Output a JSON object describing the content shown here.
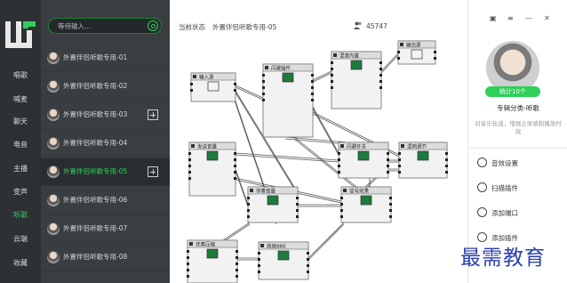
{
  "nav": {
    "items": [
      "唱歌",
      "喊麦",
      "聊天",
      "电音",
      "主播",
      "变声",
      "听歌",
      "云端",
      "收藏"
    ],
    "active_index": 6
  },
  "search": {
    "placeholder": "等待输入..."
  },
  "playlist": {
    "items": [
      {
        "label": "外置伴侣听歌专用-01",
        "has_add": false,
        "active": false
      },
      {
        "label": "外置伴侣听歌专用-02",
        "has_add": false,
        "active": false
      },
      {
        "label": "外置伴侣听歌专用-03",
        "has_add": true,
        "active": false
      },
      {
        "label": "外置伴侣听歌专用-04",
        "has_add": false,
        "active": false
      },
      {
        "label": "外置伴侣听歌专用-05",
        "has_add": true,
        "active": true
      },
      {
        "label": "外置伴侣听歌专用-06",
        "has_add": false,
        "active": false
      },
      {
        "label": "外置伴侣听歌专用-07",
        "has_add": false,
        "active": false
      },
      {
        "label": "外置伴侣听歌专用-08",
        "has_add": false,
        "active": false
      }
    ]
  },
  "topbar": {
    "status_label": "当前状态",
    "status_value": "外置伴侣听歌专用-05",
    "user_count": "45747"
  },
  "modules": [
    {
      "title": "输入源",
      "kind": "speaker"
    },
    {
      "title": "闪避插件",
      "kind": "screen"
    },
    {
      "title": "混音内置",
      "kind": "screen"
    },
    {
      "title": "输出源",
      "kind": "speaker"
    },
    {
      "title": "发送音量",
      "kind": "screen"
    },
    {
      "title": "闪避开关",
      "kind": "screen"
    },
    {
      "title": "混响调节",
      "kind": "screen"
    },
    {
      "title": "伴奏音量",
      "kind": "screen"
    },
    {
      "title": "信号效果",
      "kind": "screen"
    },
    {
      "title": "伴奏压缩",
      "kind": "screen"
    },
    {
      "title": "高级BBE",
      "kind": "screen"
    }
  ],
  "right_panel": {
    "badge": "统计10个",
    "category": "专辑分类-听歌",
    "description": "对音乐轨道，增强立体感和播放时效",
    "actions": [
      "音效设置",
      "扫描插件",
      "添加端口",
      "添加插件"
    ],
    "window_controls": [
      "skin",
      "minimize",
      "maximize",
      "close"
    ]
  },
  "watermark": "最需教育",
  "colors": {
    "accent": "#2fcf5a",
    "nav_bg": "#2e3134",
    "list_bg": "#3a3e41",
    "watermark": "#2b3fb0"
  }
}
